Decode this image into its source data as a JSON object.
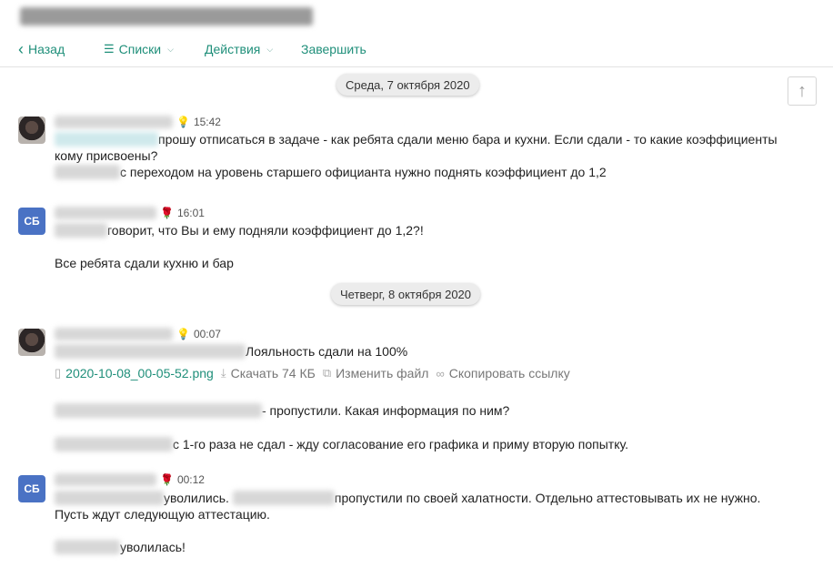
{
  "toolbar": {
    "back": "Назад",
    "lists": "Списки",
    "actions": "Действия",
    "finish": "Завершить"
  },
  "dates": {
    "d1": "Среда, 7 октября 2020",
    "d2": "Четверг, 8 октября 2020"
  },
  "messages": {
    "m1": {
      "time": "15:42",
      "l1": "прошу отписаться в задаче - как ребята сдали меню бара и кухни. Если сдали - то какие коэффициенты",
      "l2": "кому присвоены?",
      "l3": "с переходом на уровень старшего официанта нужно поднять коэффициент до 1,2"
    },
    "m2": {
      "initials": "СБ",
      "time": "16:01",
      "l1": "говорит, что Вы и ему подняли коэффициент до 1,2?!",
      "l2": "Все ребята сдали кухню и бар"
    },
    "m3": {
      "time": "00:07",
      "l1": "Лояльность сдали на 100%",
      "file": "2020-10-08_00-05-52.png",
      "download": "Скачать 74 КБ",
      "edit": "Изменить файл",
      "copy": "Скопировать ссылку",
      "l2": "- пропустили. Какая информация по ним?",
      "l3": "с 1-го раза не сдал - жду согласование его графика и приму вторую попытку."
    },
    "m4": {
      "initials": "СБ",
      "time": "00:12",
      "l1a": "уволились.",
      "l1b": "пропустили по своей халатности. Отдельно аттестовывать их не нужно.",
      "l2": "Пусть ждут следующую аттестацию.",
      "l3": "уволилась!"
    }
  }
}
